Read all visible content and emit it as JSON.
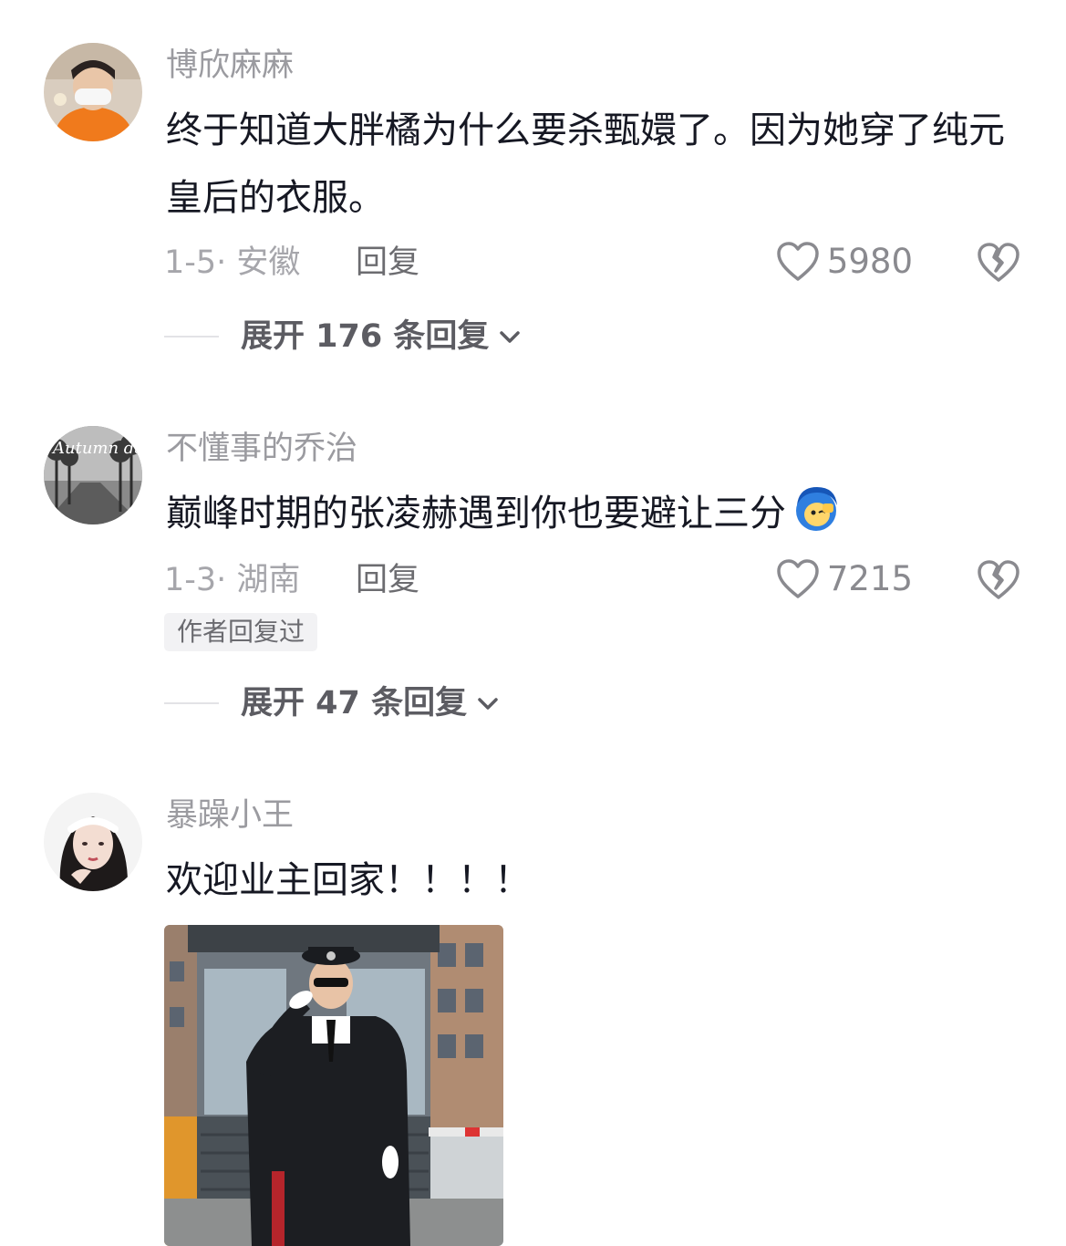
{
  "comments": [
    {
      "username": "博欣麻麻",
      "text": "终于知道大胖橘为什么要杀甄嬛了。因为她穿了纯元皇后的衣服。",
      "meta": "1-5· 安徽",
      "reply_label": "回复",
      "likes": "5980",
      "expand_label": "展开 176 条回复"
    },
    {
      "username": "不懂事的乔治",
      "text": "巅峰时期的张凌赫遇到你也要避让三分",
      "avatar_text": "Autumn day",
      "meta": "1-3· 湖南",
      "reply_label": "回复",
      "likes": "7215",
      "badge": "作者回复过",
      "expand_label": "展开 47 条回复"
    },
    {
      "username": "暴躁小王",
      "text": "欢迎业主回家！！！！"
    }
  ],
  "icons": {
    "like": "heart-outline-icon",
    "dislike": "broken-heart-icon",
    "expand": "chevron-down-icon",
    "emoji": "salute-emoji-icon"
  },
  "colors": {
    "text_primary": "#161823",
    "text_secondary": "#9b9ba0",
    "divider": "#e3e3e6"
  }
}
